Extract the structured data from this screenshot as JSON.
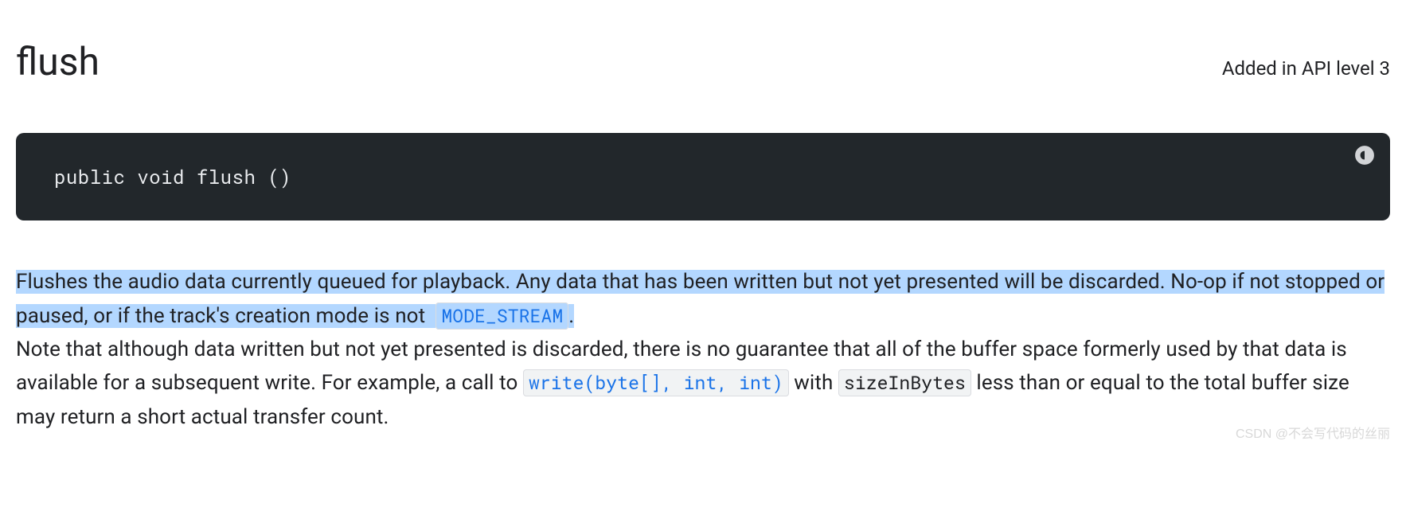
{
  "header": {
    "title": "flush",
    "api_level": "Added in API level 3"
  },
  "code_block": {
    "signature": "public void flush ()"
  },
  "description": {
    "p1_part1": "Flushes the audio data currently queued for playback. Any data that has been written but not yet presented will be discarded. No-op if not stopped or paused, or if the track's creation mode is not ",
    "p1_link1": "MODE_STREAM",
    "p1_part2": ".",
    "p2_part1": "Note that although data written but not yet presented is discarded, there is no guarantee that all of the buffer space formerly used by that data is available for a subsequent write. For example, a call to ",
    "p2_link1": "write(byte[], int, int)",
    "p2_part2": " with ",
    "p2_code1": "sizeInBytes",
    "p2_part3": " less than or equal to the total buffer size may return a short actual transfer count."
  },
  "watermark": "CSDN @不会写代码的丝丽"
}
